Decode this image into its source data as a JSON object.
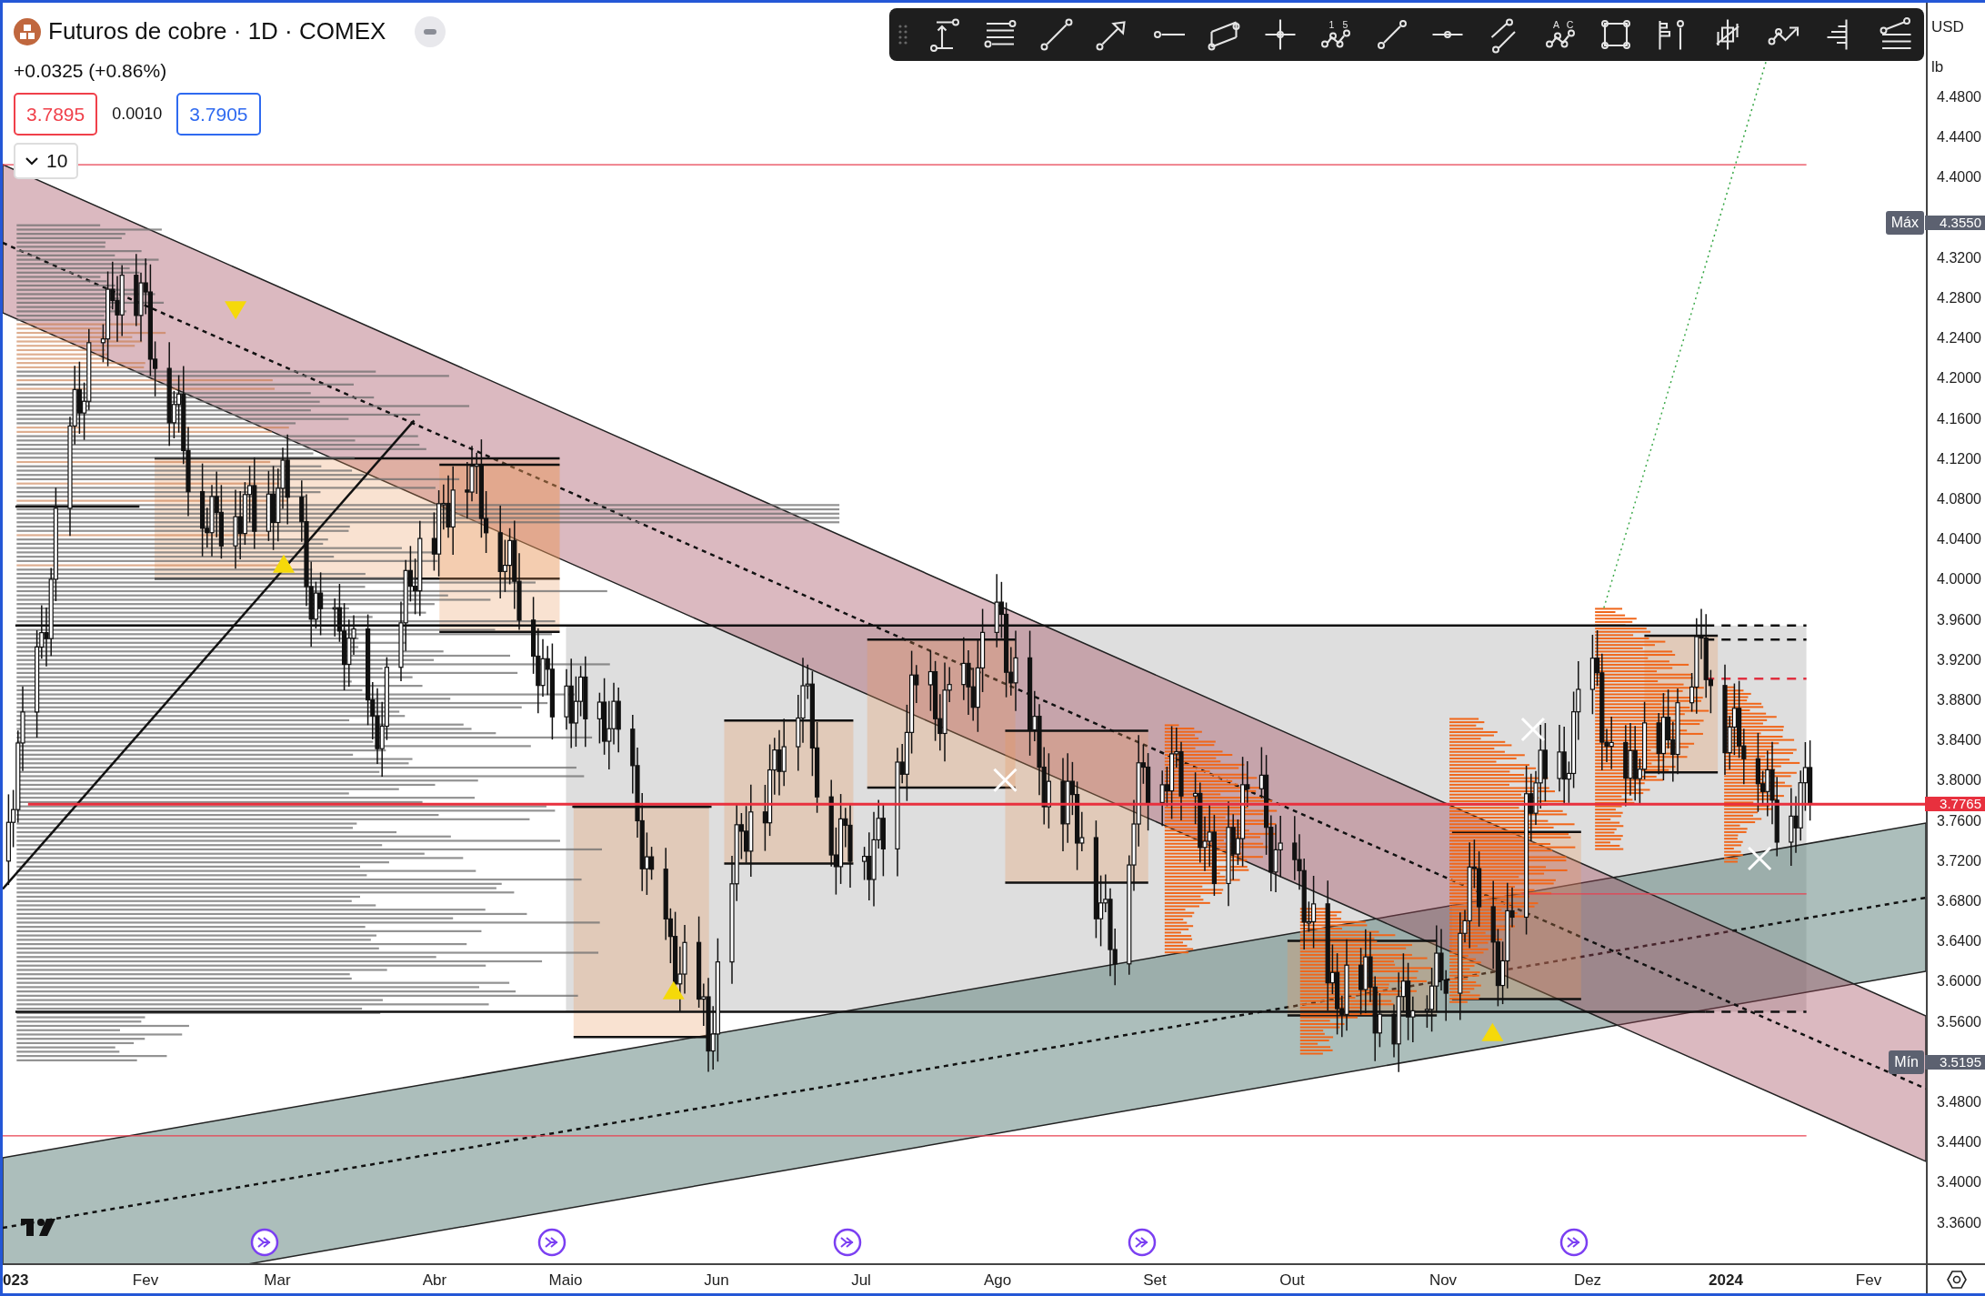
{
  "header": {
    "title": "Futuros de cobre · 1D · COMEX",
    "change": "+0.0325 (+0.86%)",
    "bid": "3.7895",
    "spread": "0.0010",
    "ask": "3.7905",
    "indicators_count": "10"
  },
  "toolbar": {
    "tools": [
      {
        "kind": "measure"
      },
      {
        "kind": "lines"
      },
      {
        "kind": "trend"
      },
      {
        "kind": "arrow"
      },
      {
        "kind": "hray"
      },
      {
        "kind": "channel"
      },
      {
        "kind": "cross"
      },
      {
        "kind": "pattern",
        "marks": [
          "1",
          "5"
        ]
      },
      {
        "kind": "segment"
      },
      {
        "kind": "hline"
      },
      {
        "kind": "parallel"
      },
      {
        "kind": "pattern",
        "marks": [
          "A",
          "C"
        ]
      },
      {
        "kind": "rect"
      },
      {
        "kind": "flag"
      },
      {
        "kind": "candles"
      },
      {
        "kind": "path"
      },
      {
        "kind": "profile"
      },
      {
        "kind": "fib"
      }
    ]
  },
  "price_axis": {
    "currency": "USD",
    "unit": "lb",
    "ticks": [
      "4.4800",
      "4.4400",
      "4.4000",
      "4.3200",
      "4.2800",
      "4.2400",
      "4.2000",
      "4.1600",
      "4.1200",
      "4.0800",
      "4.0400",
      "4.0000",
      "3.9600",
      "3.9200",
      "3.8800",
      "3.8400",
      "3.8000",
      "3.7600",
      "3.7200",
      "3.6800",
      "3.6400",
      "3.6000",
      "3.5600",
      "3.4800",
      "3.4400",
      "3.4000",
      "3.3600"
    ],
    "current_price": "3.7765",
    "max_label": "Máx",
    "max_value": "4.3550",
    "min_label": "Mín",
    "min_value": "3.5195"
  },
  "time_axis": {
    "labels": [
      {
        "text": "023",
        "bold": true
      },
      {
        "text": "Fev",
        "bold": false
      },
      {
        "text": "Mar",
        "bold": false
      },
      {
        "text": "Abr",
        "bold": false
      },
      {
        "text": "Maio",
        "bold": false
      },
      {
        "text": "Jun",
        "bold": false
      },
      {
        "text": "Jul",
        "bold": false
      },
      {
        "text": "Ago",
        "bold": false
      },
      {
        "text": "Set",
        "bold": false
      },
      {
        "text": "Out",
        "bold": false
      },
      {
        "text": "Nov",
        "bold": false
      },
      {
        "text": "Dez",
        "bold": false
      },
      {
        "text": "2024",
        "bold": true
      },
      {
        "text": "Fev",
        "bold": false
      }
    ]
  }
}
